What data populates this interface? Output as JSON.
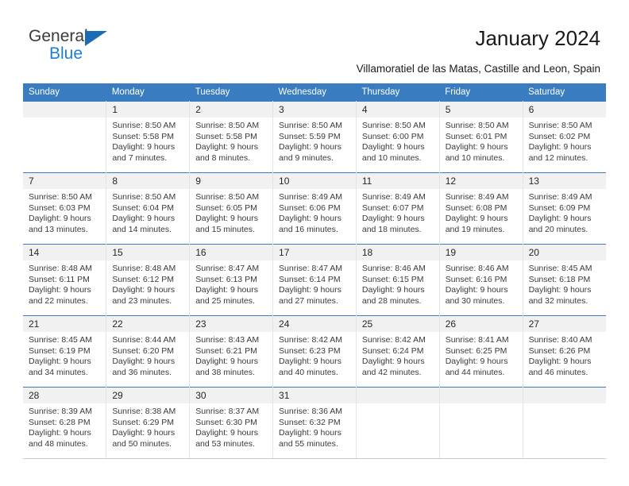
{
  "brand": {
    "name_part1": "General",
    "name_part2": "Blue",
    "triangle_color": "#1b6cb5",
    "blue_color": "#1b7fd4"
  },
  "header": {
    "title": "January 2024",
    "subtitle": "Villamoratiel de las Matas, Castille and Leon, Spain"
  },
  "colors": {
    "header_row_bg": "#3a7cc0",
    "daynum_bg": "#f1f1f1",
    "text": "#3a3a3a"
  },
  "calendar": {
    "weekdays": [
      "Sunday",
      "Monday",
      "Tuesday",
      "Wednesday",
      "Thursday",
      "Friday",
      "Saturday"
    ],
    "weeks": [
      [
        {
          "day": "",
          "lines": []
        },
        {
          "day": "1",
          "lines": [
            "Sunrise: 8:50 AM",
            "Sunset: 5:58 PM",
            "Daylight: 9 hours",
            "and 7 minutes."
          ]
        },
        {
          "day": "2",
          "lines": [
            "Sunrise: 8:50 AM",
            "Sunset: 5:58 PM",
            "Daylight: 9 hours",
            "and 8 minutes."
          ]
        },
        {
          "day": "3",
          "lines": [
            "Sunrise: 8:50 AM",
            "Sunset: 5:59 PM",
            "Daylight: 9 hours",
            "and 9 minutes."
          ]
        },
        {
          "day": "4",
          "lines": [
            "Sunrise: 8:50 AM",
            "Sunset: 6:00 PM",
            "Daylight: 9 hours",
            "and 10 minutes."
          ]
        },
        {
          "day": "5",
          "lines": [
            "Sunrise: 8:50 AM",
            "Sunset: 6:01 PM",
            "Daylight: 9 hours",
            "and 10 minutes."
          ]
        },
        {
          "day": "6",
          "lines": [
            "Sunrise: 8:50 AM",
            "Sunset: 6:02 PM",
            "Daylight: 9 hours",
            "and 12 minutes."
          ]
        }
      ],
      [
        {
          "day": "7",
          "lines": [
            "Sunrise: 8:50 AM",
            "Sunset: 6:03 PM",
            "Daylight: 9 hours",
            "and 13 minutes."
          ]
        },
        {
          "day": "8",
          "lines": [
            "Sunrise: 8:50 AM",
            "Sunset: 6:04 PM",
            "Daylight: 9 hours",
            "and 14 minutes."
          ]
        },
        {
          "day": "9",
          "lines": [
            "Sunrise: 8:50 AM",
            "Sunset: 6:05 PM",
            "Daylight: 9 hours",
            "and 15 minutes."
          ]
        },
        {
          "day": "10",
          "lines": [
            "Sunrise: 8:49 AM",
            "Sunset: 6:06 PM",
            "Daylight: 9 hours",
            "and 16 minutes."
          ]
        },
        {
          "day": "11",
          "lines": [
            "Sunrise: 8:49 AM",
            "Sunset: 6:07 PM",
            "Daylight: 9 hours",
            "and 18 minutes."
          ]
        },
        {
          "day": "12",
          "lines": [
            "Sunrise: 8:49 AM",
            "Sunset: 6:08 PM",
            "Daylight: 9 hours",
            "and 19 minutes."
          ]
        },
        {
          "day": "13",
          "lines": [
            "Sunrise: 8:49 AM",
            "Sunset: 6:09 PM",
            "Daylight: 9 hours",
            "and 20 minutes."
          ]
        }
      ],
      [
        {
          "day": "14",
          "lines": [
            "Sunrise: 8:48 AM",
            "Sunset: 6:11 PM",
            "Daylight: 9 hours",
            "and 22 minutes."
          ]
        },
        {
          "day": "15",
          "lines": [
            "Sunrise: 8:48 AM",
            "Sunset: 6:12 PM",
            "Daylight: 9 hours",
            "and 23 minutes."
          ]
        },
        {
          "day": "16",
          "lines": [
            "Sunrise: 8:47 AM",
            "Sunset: 6:13 PM",
            "Daylight: 9 hours",
            "and 25 minutes."
          ]
        },
        {
          "day": "17",
          "lines": [
            "Sunrise: 8:47 AM",
            "Sunset: 6:14 PM",
            "Daylight: 9 hours",
            "and 27 minutes."
          ]
        },
        {
          "day": "18",
          "lines": [
            "Sunrise: 8:46 AM",
            "Sunset: 6:15 PM",
            "Daylight: 9 hours",
            "and 28 minutes."
          ]
        },
        {
          "day": "19",
          "lines": [
            "Sunrise: 8:46 AM",
            "Sunset: 6:16 PM",
            "Daylight: 9 hours",
            "and 30 minutes."
          ]
        },
        {
          "day": "20",
          "lines": [
            "Sunrise: 8:45 AM",
            "Sunset: 6:18 PM",
            "Daylight: 9 hours",
            "and 32 minutes."
          ]
        }
      ],
      [
        {
          "day": "21",
          "lines": [
            "Sunrise: 8:45 AM",
            "Sunset: 6:19 PM",
            "Daylight: 9 hours",
            "and 34 minutes."
          ]
        },
        {
          "day": "22",
          "lines": [
            "Sunrise: 8:44 AM",
            "Sunset: 6:20 PM",
            "Daylight: 9 hours",
            "and 36 minutes."
          ]
        },
        {
          "day": "23",
          "lines": [
            "Sunrise: 8:43 AM",
            "Sunset: 6:21 PM",
            "Daylight: 9 hours",
            "and 38 minutes."
          ]
        },
        {
          "day": "24",
          "lines": [
            "Sunrise: 8:42 AM",
            "Sunset: 6:23 PM",
            "Daylight: 9 hours",
            "and 40 minutes."
          ]
        },
        {
          "day": "25",
          "lines": [
            "Sunrise: 8:42 AM",
            "Sunset: 6:24 PM",
            "Daylight: 9 hours",
            "and 42 minutes."
          ]
        },
        {
          "day": "26",
          "lines": [
            "Sunrise: 8:41 AM",
            "Sunset: 6:25 PM",
            "Daylight: 9 hours",
            "and 44 minutes."
          ]
        },
        {
          "day": "27",
          "lines": [
            "Sunrise: 8:40 AM",
            "Sunset: 6:26 PM",
            "Daylight: 9 hours",
            "and 46 minutes."
          ]
        }
      ],
      [
        {
          "day": "28",
          "lines": [
            "Sunrise: 8:39 AM",
            "Sunset: 6:28 PM",
            "Daylight: 9 hours",
            "and 48 minutes."
          ]
        },
        {
          "day": "29",
          "lines": [
            "Sunrise: 8:38 AM",
            "Sunset: 6:29 PM",
            "Daylight: 9 hours",
            "and 50 minutes."
          ]
        },
        {
          "day": "30",
          "lines": [
            "Sunrise: 8:37 AM",
            "Sunset: 6:30 PM",
            "Daylight: 9 hours",
            "and 53 minutes."
          ]
        },
        {
          "day": "31",
          "lines": [
            "Sunrise: 8:36 AM",
            "Sunset: 6:32 PM",
            "Daylight: 9 hours",
            "and 55 minutes."
          ]
        },
        {
          "day": "",
          "lines": []
        },
        {
          "day": "",
          "lines": []
        },
        {
          "day": "",
          "lines": []
        }
      ]
    ]
  }
}
